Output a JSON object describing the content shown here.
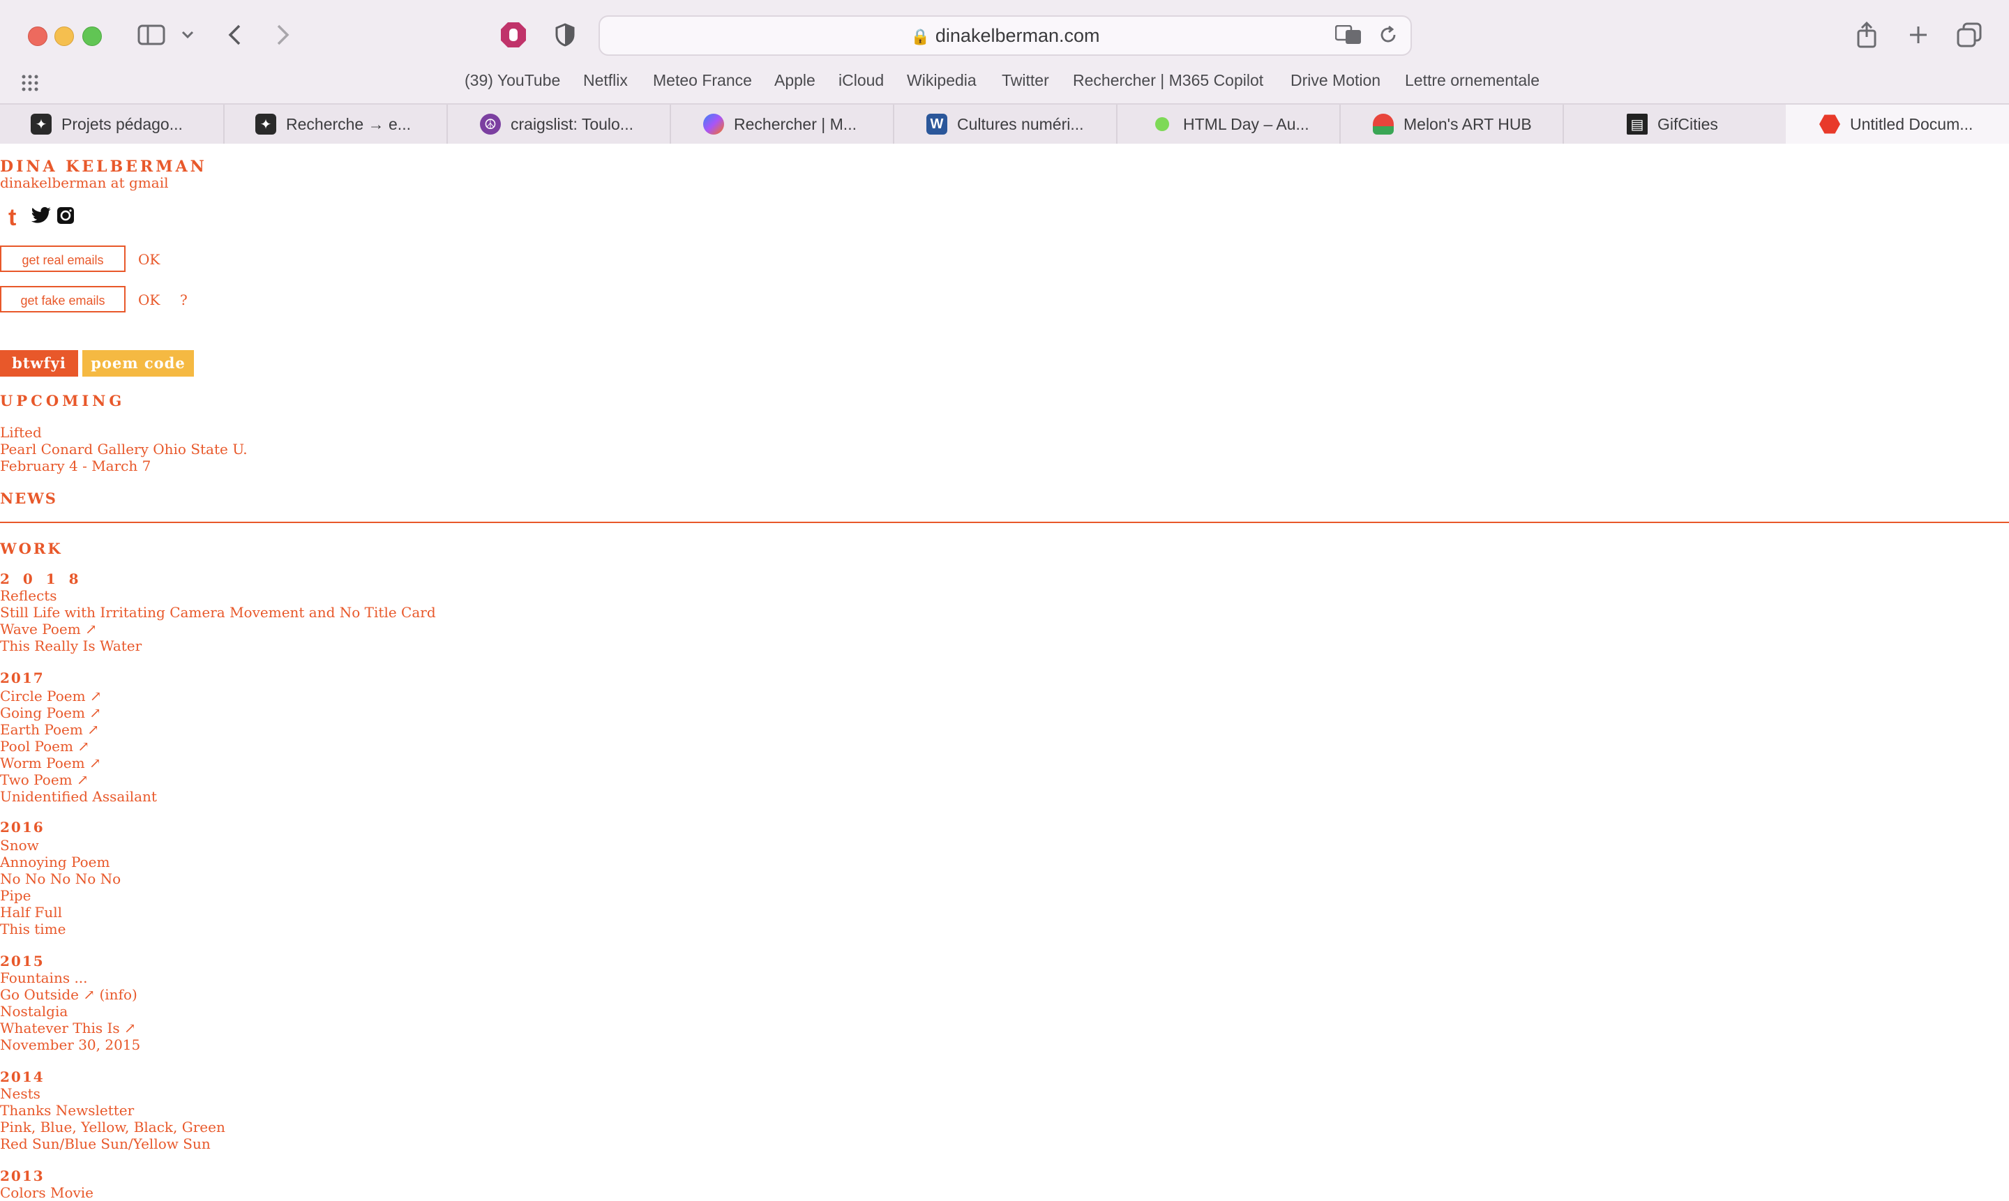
{
  "browser": {
    "url": "dinakelberman.com",
    "bookmarks": [
      "(39) YouTube",
      "Netflix",
      "Meteo France",
      "Apple",
      "iCloud",
      "Wikipedia",
      "Twitter",
      "Rechercher | M365 Copilot",
      "Drive Motion",
      "Lettre ornementale"
    ],
    "tabs": [
      {
        "label": "Projets pédago...",
        "icon": "cursor-icon"
      },
      {
        "label": "Recherche → e...",
        "icon": "cursor-icon"
      },
      {
        "label": "craigslist: Toulo...",
        "icon": "peace-icon"
      },
      {
        "label": "Rechercher | M...",
        "icon": "copilot-icon"
      },
      {
        "label": "Cultures numéri...",
        "icon": "word-icon"
      },
      {
        "label": "HTML Day – Au...",
        "icon": "green-dot-icon"
      },
      {
        "label": "Melon's ART HUB",
        "icon": "watermelon-icon"
      },
      {
        "label": "GifCities",
        "icon": "archive-icon"
      },
      {
        "label": "Untitled Docum...",
        "icon": "red-hexagon-icon"
      }
    ],
    "accent_color": "#e8582a"
  },
  "site": {
    "name": "DINA KELBERMAN",
    "email": "dinakelberman at gmail",
    "buttons": {
      "real": "get real emails",
      "fake": "get fake emails",
      "ok": "OK",
      "question": "?"
    },
    "chips": {
      "btwfyi": "btwfyi",
      "poem_code": "poem code"
    },
    "upcoming": {
      "heading": "UPCOMING",
      "lines": [
        "Lifted",
        "Pearl Conard Gallery Ohio State U.",
        "February 4 - March 7"
      ]
    },
    "news_heading": "NEWS",
    "work_heading": "WORK",
    "years": [
      {
        "year": "2 0 1 8",
        "items": [
          "Reflects",
          "Still Life with Irritating Camera Movement and No Title Card",
          "Wave Poem ↗",
          "This Really Is Water"
        ]
      },
      {
        "year": "2017",
        "items": [
          "Circle Poem ↗",
          "Going Poem ↗",
          "Earth Poem ↗",
          "Pool Poem ↗",
          "Worm Poem ↗",
          "Two Poem ↗",
          "Unidentified Assailant"
        ]
      },
      {
        "year": "2016",
        "items": [
          "Snow",
          "Annoying Poem",
          "No No No No No",
          "Pipe",
          "Half Full",
          "This time"
        ]
      },
      {
        "year": "2015",
        "items": [
          "Fountains ...",
          "Go Outside ↗ (info)",
          "Nostalgia",
          "Whatever This Is ↗",
          "November 30, 2015"
        ]
      },
      {
        "year": "2014",
        "items": [
          "Nests",
          "Thanks Newsletter",
          "Pink, Blue, Yellow, Black, Green",
          "Red Sun/Blue Sun/Yellow Sun"
        ]
      },
      {
        "year": "2013",
        "items": [
          "Colors Movie"
        ]
      }
    ]
  }
}
